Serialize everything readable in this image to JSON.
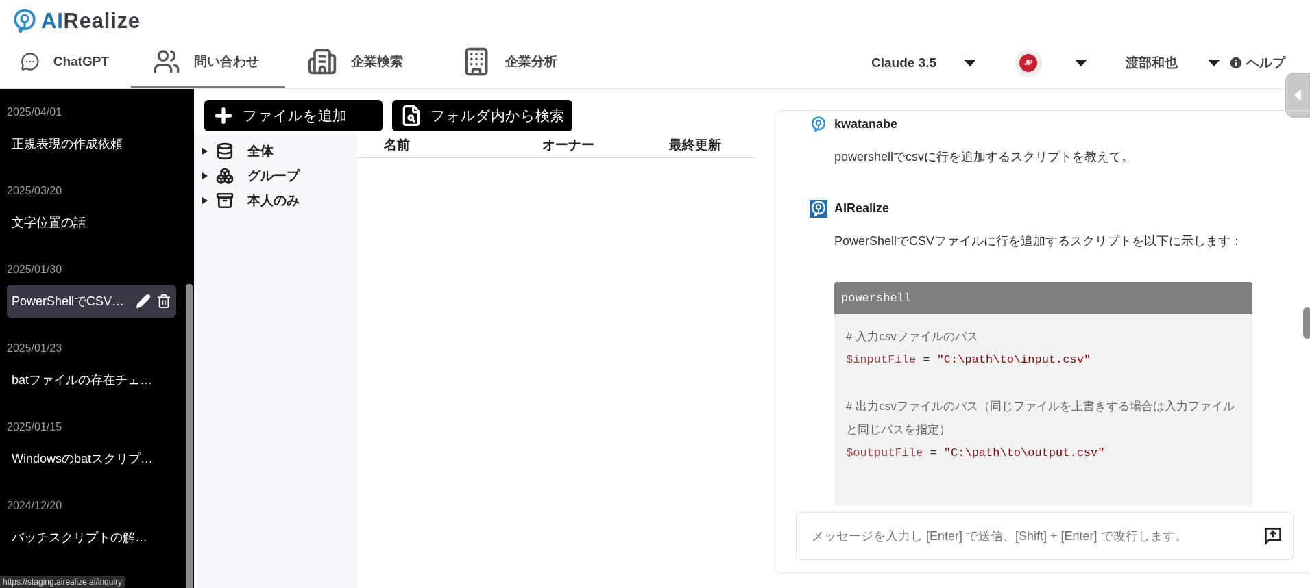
{
  "logo": {
    "text": "AIRealize"
  },
  "nav": [
    {
      "label": "ChatGPT",
      "kind": "chat",
      "selected": false
    },
    {
      "label": "問い合わせ",
      "kind": "people",
      "selected": true
    },
    {
      "label": "企業検索",
      "kind": "city",
      "selected": false
    },
    {
      "label": "企業分析",
      "kind": "building",
      "selected": false
    }
  ],
  "header_right": {
    "model": "Claude 3.5",
    "language": "JP",
    "user": "渡部和也",
    "help": "ヘルプ"
  },
  "history": [
    {
      "date": "2025/04/01",
      "title": "正規表現の作成依頼",
      "selected": false
    },
    {
      "date": "2025/03/20",
      "title": "文字位置の話",
      "selected": false
    },
    {
      "date": "2025/01/30",
      "title": "PowerShellでCSV…",
      "selected": true
    },
    {
      "date": "2025/01/23",
      "title": "batファイルの存在チェ…",
      "selected": false
    },
    {
      "date": "2025/01/15",
      "title": "Windowsのbatスクリプ…",
      "selected": false
    },
    {
      "date": "2024/12/20",
      "title": "バッチスクリプトの解…",
      "selected": false
    }
  ],
  "status_url": "https://staging.airealize.ai/inquiry",
  "buttons": [
    {
      "label": "ファイルを追加",
      "kind": "add"
    },
    {
      "label": "フォルダ内から検索",
      "kind": "search"
    }
  ],
  "tree": [
    {
      "label": "全体",
      "kind": "all",
      "expanded": false
    },
    {
      "label": "グループ",
      "kind": "group",
      "expanded": false
    },
    {
      "label": "本人のみ",
      "kind": "personal",
      "expanded": false
    }
  ],
  "table": {
    "columns": [
      "名前",
      "オーナー",
      "最終更新"
    ]
  },
  "chat": {
    "messages": [
      {
        "sender": "kwatanabe",
        "kind": "user",
        "text": "powershellでcsvに行を追加するスクリプトを教えて。"
      },
      {
        "sender": "AIRealize",
        "kind": "assistant",
        "text": "PowerShellでCSVファイルに行を追加するスクリプトを以下に示します：",
        "code": {
          "language": "powershell",
          "lines": [
            {
              "kind": "comment",
              "text": "# 入力csvファイルのパス"
            },
            {
              "kind": "assign",
              "variable": "$inputFile",
              "operator": "=",
              "value": "\"C:\\path\\to\\input.csv\""
            },
            {
              "kind": "blank"
            },
            {
              "kind": "comment",
              "text": "# 出力csvファイルのパス（同じファイルを上書きする場合は入力ファイルと同じパスを指定）"
            },
            {
              "kind": "assign",
              "variable": "$outputFile",
              "operator": "=",
              "value": "\"C:\\path\\to\\output.csv\""
            }
          ]
        }
      }
    ],
    "input": {
      "placeholder": "メッセージを入力し [Enter] で送信、[Shift] + [Enter] で改行します。"
    }
  }
}
